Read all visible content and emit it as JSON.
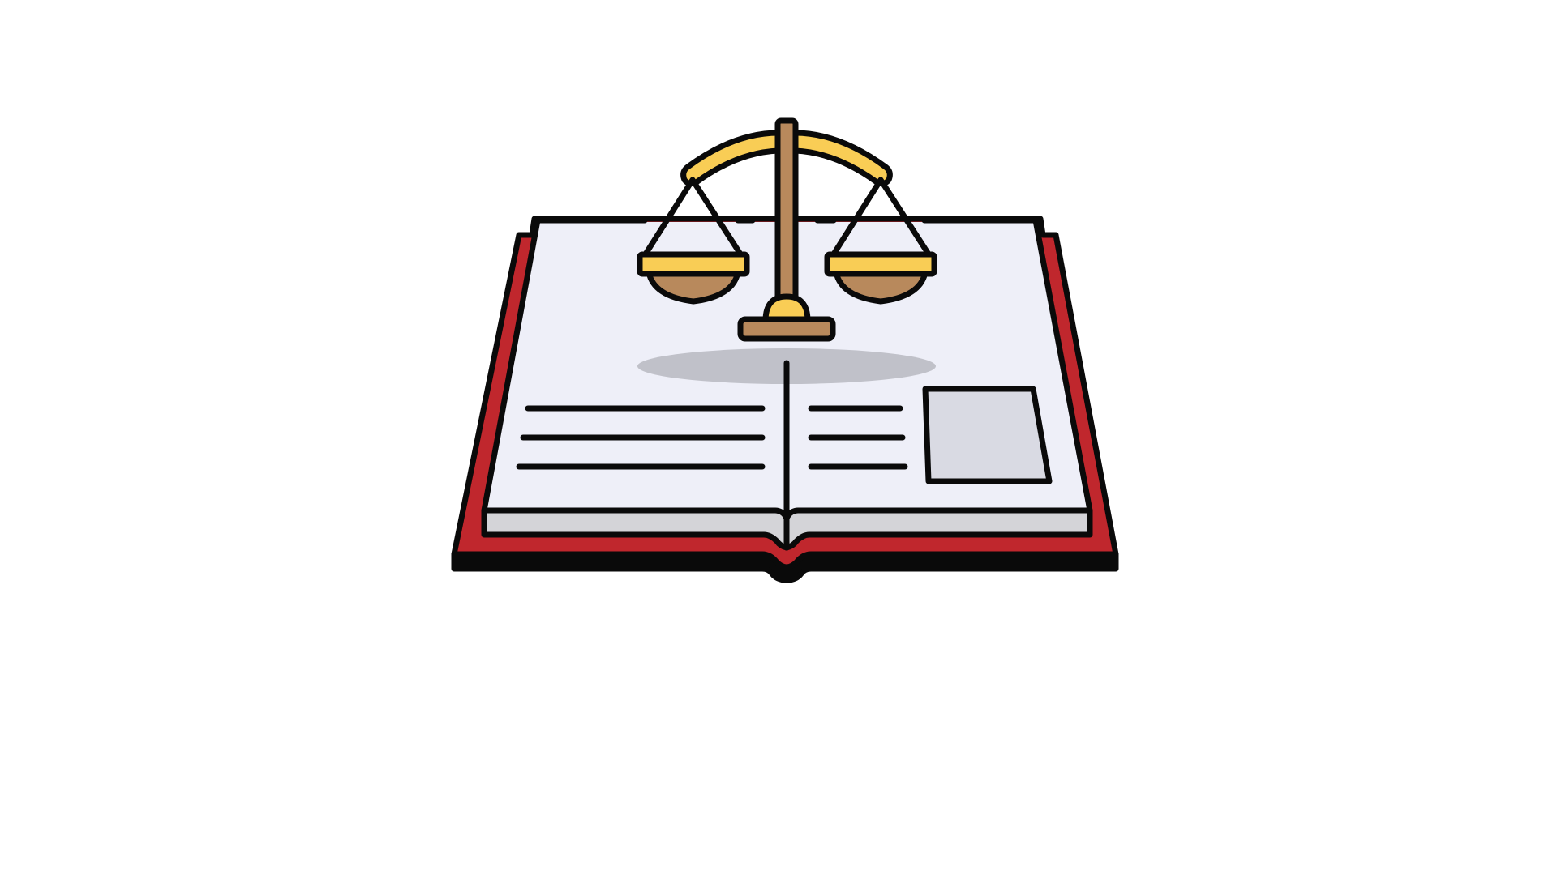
{
  "scene": {
    "subject": "law-book-with-scales-of-justice",
    "icons": [
      "open-book-icon",
      "scales-of-justice-icon"
    ]
  },
  "colors": {
    "background": "#ffffff",
    "outline": "#0a0a0a",
    "book_cover": "#c0272d",
    "page": "#eeeff8",
    "page_edge": "#d4d4d8",
    "picture_box": "#d9dae3",
    "shadow": "#c0c1c9",
    "brass_light": "#f9cd55",
    "brass_dark": "#b8895c"
  }
}
